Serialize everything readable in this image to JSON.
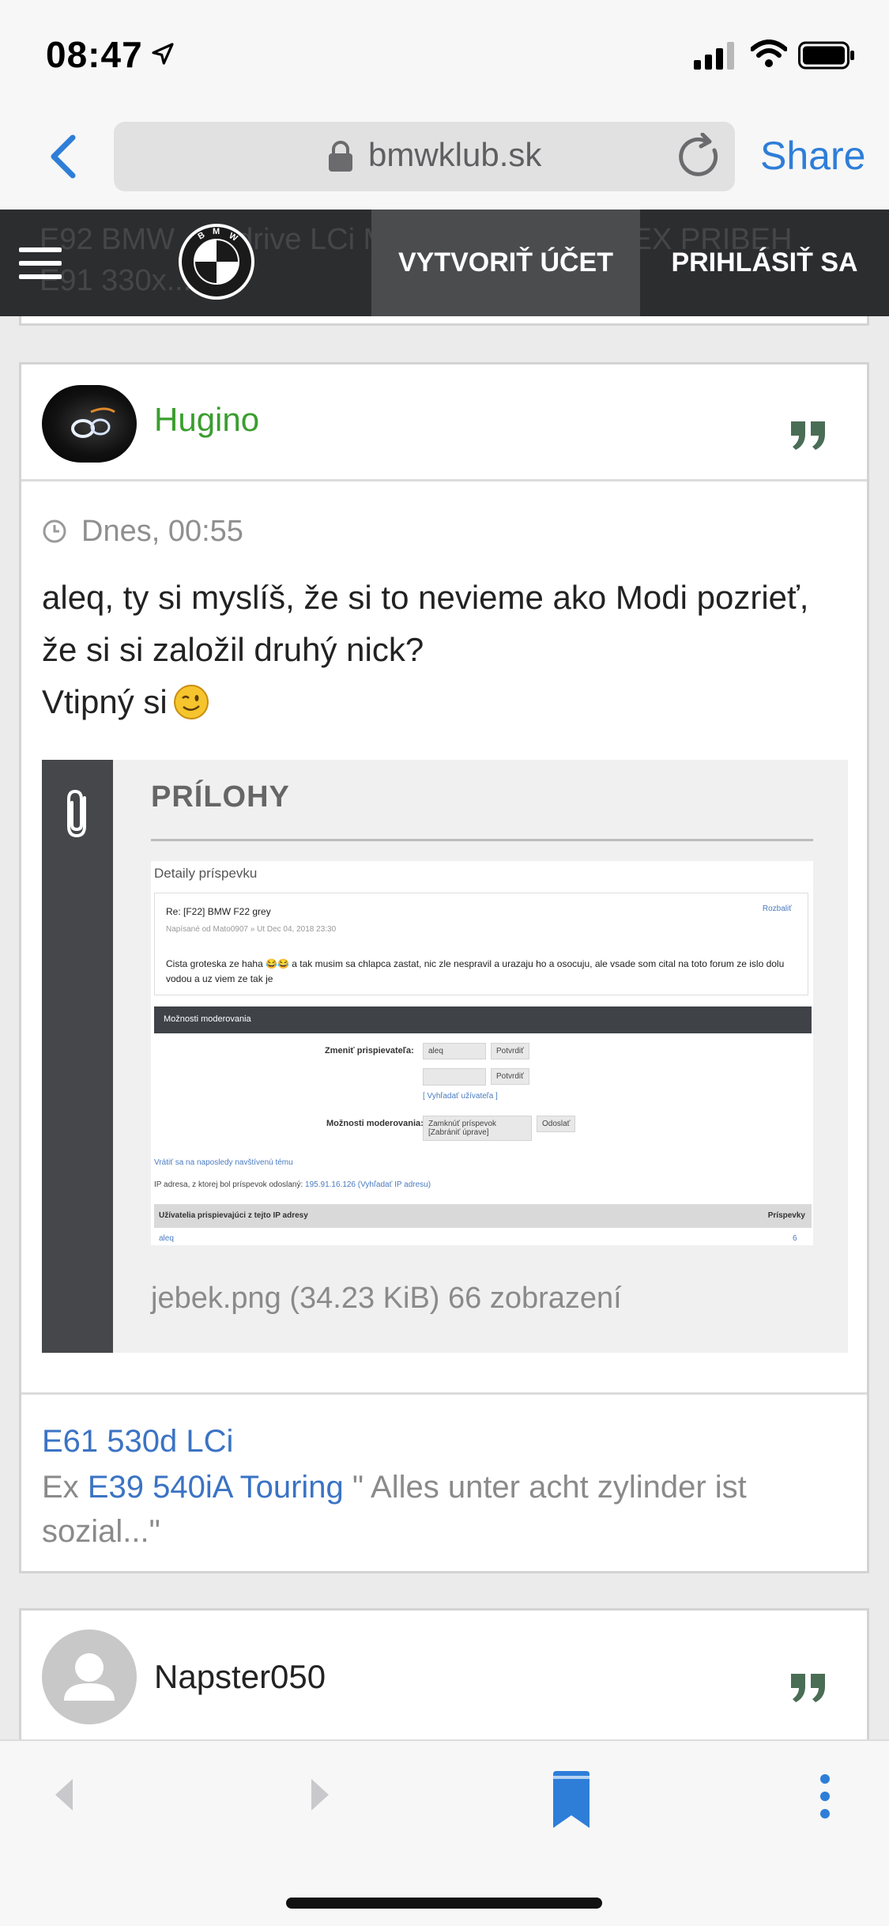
{
  "status_bar": {
    "time": "08:47"
  },
  "browser": {
    "url": "bmwklub.sk",
    "share_label": "Share"
  },
  "site_nav": {
    "create_account": "VYTVORIŤ ÚČET",
    "login": "PRIHLÁSIŤ SA",
    "background_text_line1": "E92 BMW ... Xdrive LCi Msportperformance EX PRIBEH",
    "background_text_line2": "E91 330x..."
  },
  "post": {
    "username": "Hugino",
    "time": "Dnes, 00:55",
    "body_line1": "aleq, ty si myslíš, že si to nevieme ako Modi pozrieť,",
    "body_line2": "že si si založil druhý nick?",
    "body_line3": "Vtipný si",
    "attachments_title": "PRÍLOHY",
    "attachment_filename": "jebek.png (34.23 KiB) 66 zobrazení",
    "signature_line1": "E61 530d LCi",
    "signature_prefix": "Ex",
    "signature_link": "E39 540iA Touring",
    "signature_quote": "\" Alles unter acht zylinder ist sozial...\""
  },
  "attachment_image": {
    "title": "Detaily príspevku",
    "subject": "Re: [F22] BMW F22 grey",
    "written_by": "Napísané od Mato0907 » Ut Dec 04, 2018 23:30",
    "expand": "Rozbaliť",
    "text": "Cista groteska ze haha 😂😂 a tak musim sa chlapca zastat, nic zle nespravil a urazaju ho a osocuju, ale vsade som cital na toto forum ze islo dolu vodou a uz viem ze tak je",
    "moderation_bar": "Možnosti moderovania",
    "change_author_label": "Zmeniť prispievateľa:",
    "author_value": "aleq",
    "confirm": "Potvrdiť",
    "find_user": "[ Vyhľadať užívateľa ]",
    "moderation_label": "Možnosti moderovania:",
    "moderation_value": "Zamknúť príspevok [Zabrániť úprave]",
    "send": "Odoslať",
    "return_link": "Vrátiť sa na naposledy navštívenú tému",
    "ip_text": "IP adresa, z ktorej bol príspevok odoslaný:",
    "ip_value": "195.91.16.126",
    "ip_lookup": "(Vyhľadať IP adresu)",
    "table_header_users": "Užívatelia prispievajúci z tejto IP adresy",
    "table_header_posts": "Príspevky",
    "row_user": "aleq",
    "row_posts": "6"
  },
  "next_post": {
    "username": "Napster050"
  },
  "colors": {
    "accent_blue": "#2e7ed8",
    "username_green": "#3a9e2e",
    "nav_dark": "#2c2d2f",
    "quote_green": "#4a6d55"
  }
}
